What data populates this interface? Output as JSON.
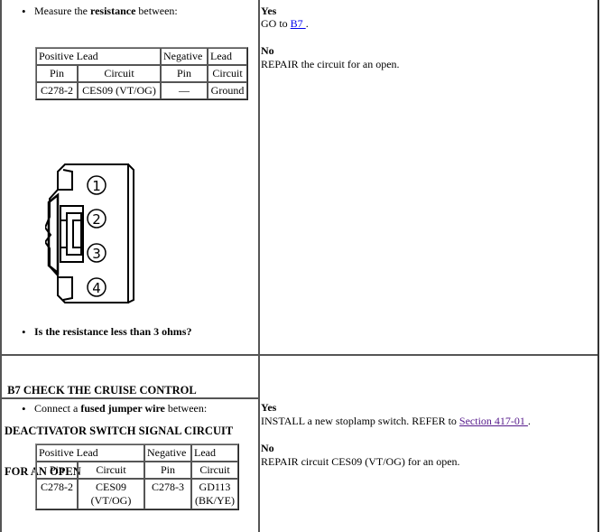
{
  "step_b6": {
    "instruction_prefix": "Measure the ",
    "instruction_bold": "resistance",
    "instruction_suffix": " between:",
    "table": {
      "group_headers": [
        "Positive Lead",
        "Negative Lead"
      ],
      "group_headers_split": [
        "Positive",
        "Lead",
        "Negative",
        "Lead"
      ],
      "column_headers": [
        "Pin",
        "Circuit",
        "Pin",
        "Circuit"
      ],
      "rows": [
        [
          "C278-2",
          "CES09 (VT/OG)",
          "—",
          "Ground"
        ]
      ]
    },
    "connector": {
      "icon": "connector-diagram",
      "pins": [
        "1",
        "2",
        "3",
        "4"
      ]
    },
    "question": "Is the resistance less than 3 ohms?",
    "yes_label": "Yes",
    "yes_text_prefix": "GO to ",
    "yes_link": "B7 ",
    "yes_text_suffix": ".",
    "no_label": "No",
    "no_text": "REPAIR the circuit for an open."
  },
  "step_b7": {
    "heading_line1": " B7 CHECK THE CRUISE CONTROL",
    "heading_line2": "DEACTIVATOR SWITCH SIGNAL CIRCUIT",
    "heading_line3": "FOR AN OPEN",
    "instruction_prefix": "Connect a ",
    "instruction_bold": "fused jumper wire",
    "instruction_suffix": " between:",
    "table": {
      "group_headers_split": [
        "Positive",
        "Lead",
        "Negative",
        "Lead"
      ],
      "column_headers": [
        "Pin",
        "Circuit",
        "Pin",
        "Circuit"
      ],
      "rows": [
        [
          "C278-2",
          "CES09",
          "(VT/OG)",
          "C278-3",
          "GD113",
          "(BK/YE)"
        ]
      ]
    },
    "yes_label": "Yes",
    "yes_text_prefix": "INSTALL a new stoplamp switch. REFER to ",
    "yes_link": "Section 417-01 ",
    "yes_text_suffix": ".",
    "no_label": "No",
    "no_text": "REPAIR circuit CES09 (VT/OG) for an open."
  },
  "colors": {
    "link": "#0000ee",
    "visited_link": "#551a8b",
    "border": "#555555"
  }
}
